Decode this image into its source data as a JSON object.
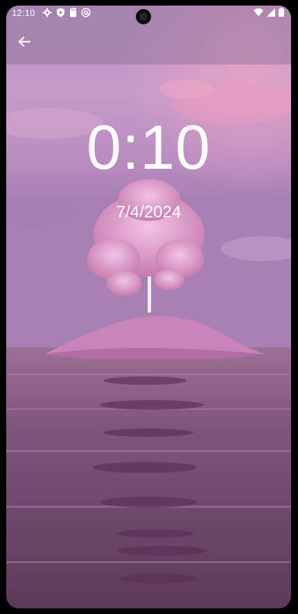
{
  "status_bar": {
    "time": "12:10",
    "left_icons": [
      "gear-icon",
      "shield-play-icon",
      "sd-card-icon",
      "at-sign-icon"
    ],
    "right_icons": [
      "wifi-icon",
      "cellular-signal-icon",
      "battery-icon"
    ]
  },
  "app_bar": {
    "back_icon": "arrow-left-icon"
  },
  "clock": {
    "time": "0:10",
    "date": "7/4/2024"
  },
  "colors": {
    "sky_top": "#b592c4",
    "sky_pink": "#e7a4c7",
    "water": "#6a4465",
    "tree": "#e6a6d3"
  }
}
